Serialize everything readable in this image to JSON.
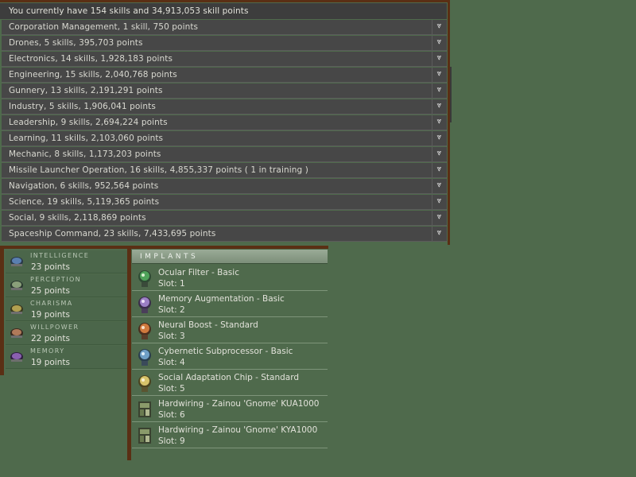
{
  "summary": "You currently have 154 skills and 34,913,053 skill points",
  "skill_groups": [
    {
      "label": "Corporation Management, 1 skill, 750 points"
    },
    {
      "label": "Drones, 5 skills, 395,703 points"
    },
    {
      "label": "Electronics, 14 skills, 1,928,183 points"
    },
    {
      "label": "Engineering, 15 skills, 2,040,768 points"
    },
    {
      "label": "Gunnery, 13 skills, 2,191,291 points"
    },
    {
      "label": "Industry, 5 skills, 1,906,041 points"
    },
    {
      "label": "Leadership, 9 skills, 2,694,224 points"
    },
    {
      "label": "Learning, 11 skills, 2,103,060 points"
    },
    {
      "label": "Mechanic, 8 skills, 1,173,203 points"
    },
    {
      "label": "Missile Launcher Operation, 16 skills, 4,855,337 points ( 1 in training )"
    },
    {
      "label": "Navigation, 6 skills, 952,564 points"
    },
    {
      "label": "Science, 19 skills, 5,119,365 points"
    },
    {
      "label": "Social, 9 skills, 2,118,869 points"
    },
    {
      "label": "Spaceship Command, 23 skills, 7,433,695 points"
    }
  ],
  "expand_glyph": "⩔",
  "attributes": [
    {
      "name": "INTELLIGENCE",
      "value": "23 points",
      "icon": "intelligence-icon",
      "color": "#5a7fb0"
    },
    {
      "name": "PERCEPTION",
      "value": "25 points",
      "icon": "perception-icon",
      "color": "#8aa07a"
    },
    {
      "name": "CHARISMA",
      "value": "19 points",
      "icon": "charisma-icon",
      "color": "#b0a050"
    },
    {
      "name": "WILLPOWER",
      "value": "22 points",
      "icon": "willpower-icon",
      "color": "#b07a5a"
    },
    {
      "name": "MEMORY",
      "value": "19 points",
      "icon": "memory-icon",
      "color": "#8a60b0"
    }
  ],
  "implants_header": "IMPLANTS",
  "implants": [
    {
      "name": "Ocular Filter - Basic",
      "slot": "Slot: 1",
      "icon": "ocular-filter-icon",
      "color": "#4fa35a"
    },
    {
      "name": "Memory Augmentation - Basic",
      "slot": "Slot: 2",
      "icon": "memory-augmentation-icon",
      "color": "#9b7fc4"
    },
    {
      "name": "Neural Boost - Standard",
      "slot": "Slot: 3",
      "icon": "neural-boost-icon",
      "color": "#d07a3e"
    },
    {
      "name": "Cybernetic Subprocessor - Basic",
      "slot": "Slot: 4",
      "icon": "cybernetic-subprocessor-icon",
      "color": "#6f9fc6"
    },
    {
      "name": "Social Adaptation Chip - Standard",
      "slot": "Slot: 5",
      "icon": "social-adaptation-chip-icon",
      "color": "#d6c36a"
    },
    {
      "name": "Hardwiring - Zainou 'Gnome' KUA1000",
      "slot": "Slot: 6",
      "icon": "hardwiring-icon",
      "color": "#8a9a6a"
    },
    {
      "name": "Hardwiring - Zainou 'Gnome' KYA1000",
      "slot": "Slot: 9",
      "icon": "hardwiring-icon",
      "color": "#8a9a6a"
    }
  ]
}
